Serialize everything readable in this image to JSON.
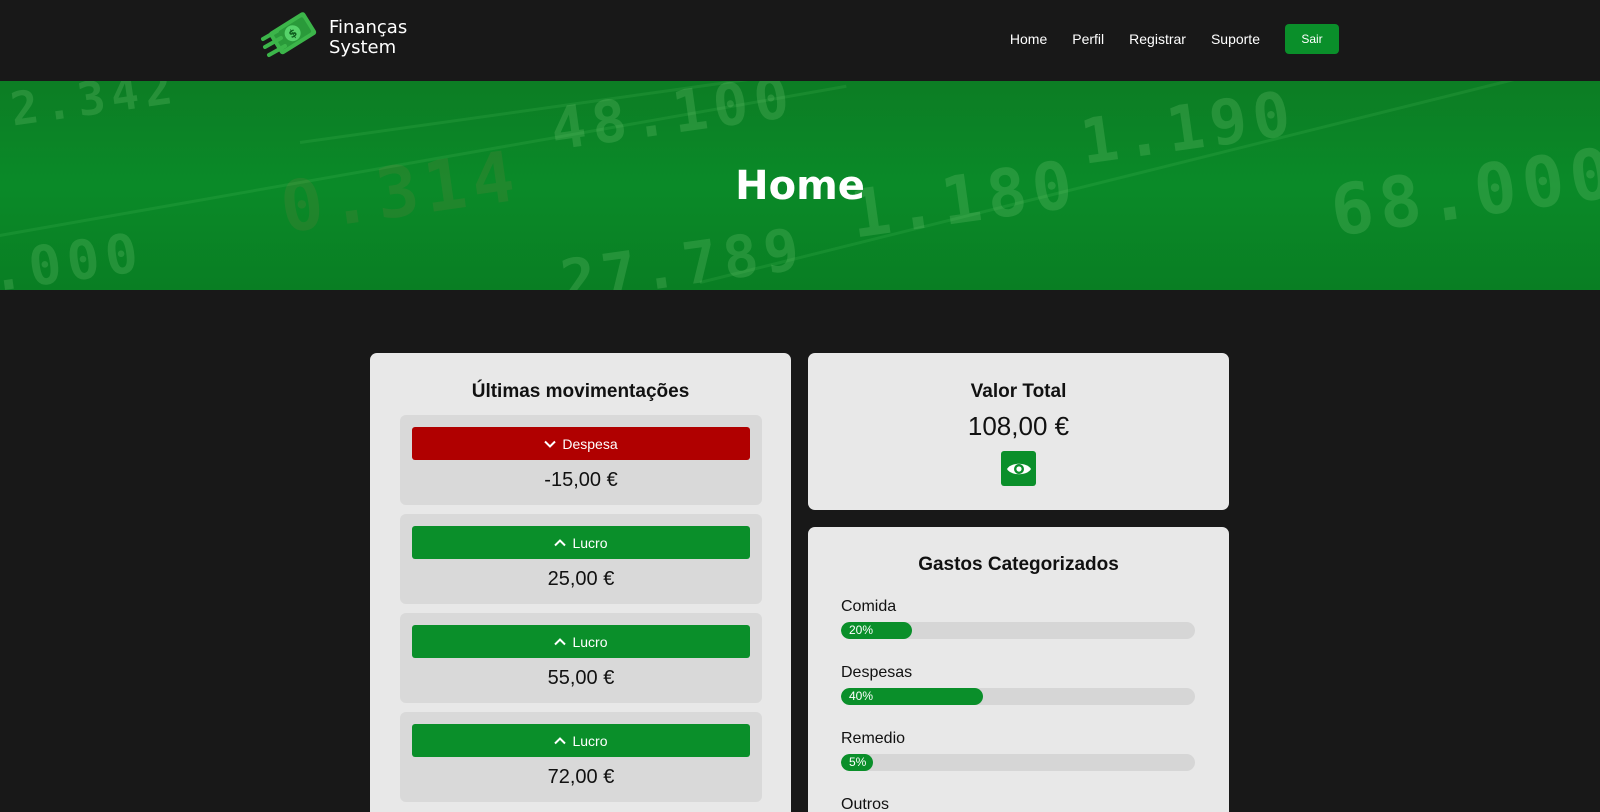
{
  "brand": {
    "line1": "Finanças",
    "line2": "System",
    "icon": "money-logo-icon"
  },
  "nav": {
    "links": [
      "Home",
      "Perfil",
      "Registrar",
      "Suporte"
    ],
    "logout_label": "Sair"
  },
  "hero": {
    "title": "Home"
  },
  "movements": {
    "title": "Últimas movimentações",
    "items": [
      {
        "type": "Despesa",
        "direction": "down",
        "value": "-15,00 €"
      },
      {
        "type": "Lucro",
        "direction": "up",
        "value": "25,00 €"
      },
      {
        "type": "Lucro",
        "direction": "up",
        "value": "55,00 €"
      },
      {
        "type": "Lucro",
        "direction": "up",
        "value": "72,00 €"
      }
    ]
  },
  "total": {
    "title": "Valor Total",
    "value": "108,00 €",
    "toggle_icon": "eye-icon"
  },
  "categories": {
    "title": "Gastos Categorizados",
    "items": [
      {
        "label": "Comida",
        "percent_label": "20%",
        "percent": 20
      },
      {
        "label": "Despesas",
        "percent_label": "40%",
        "percent": 40
      },
      {
        "label": "Remedio",
        "percent_label": "5%",
        "percent": 5
      },
      {
        "label": "Outros"
      }
    ]
  },
  "colors": {
    "background": "#181818",
    "accent": "#0a8f2a",
    "danger": "#b00000",
    "card": "#e8e8e8"
  }
}
